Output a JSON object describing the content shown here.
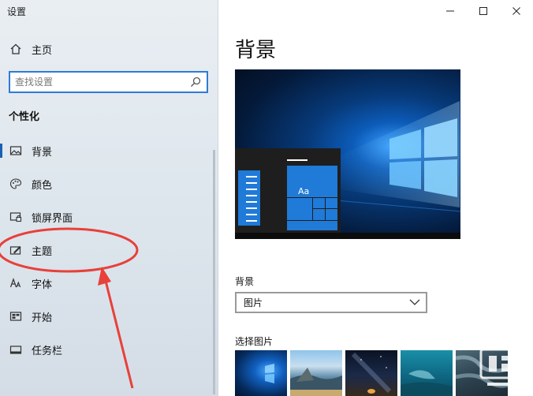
{
  "window": {
    "title": "设置",
    "controls": [
      "minimize-icon",
      "maximize-icon",
      "close-icon"
    ]
  },
  "sidebar": {
    "home_label": "主页",
    "search": {
      "placeholder": "查找设置",
      "value": ""
    },
    "section_title": "个性化",
    "items": [
      {
        "label": "背景",
        "icon": "image-icon",
        "selected": true
      },
      {
        "label": "颜色",
        "icon": "palette-icon",
        "selected": false
      },
      {
        "label": "锁屏界面",
        "icon": "lock-screen-icon",
        "selected": false
      },
      {
        "label": "主题",
        "icon": "theme-icon",
        "selected": false
      },
      {
        "label": "字体",
        "icon": "font-icon",
        "selected": false
      },
      {
        "label": "开始",
        "icon": "start-icon",
        "selected": false
      },
      {
        "label": "任务栏",
        "icon": "taskbar-icon",
        "selected": false
      }
    ]
  },
  "main": {
    "page_title": "背景",
    "preview": {
      "tile_text": "Aa"
    },
    "background_label": "背景",
    "background_dropdown": {
      "selected": "图片"
    },
    "choose_picture_label": "选择图片"
  },
  "annotation": {
    "color": "#e8403a"
  },
  "colors": {
    "accent": "#1a5fb4",
    "search_border": "#2f7bd6",
    "tile_blue": "#1f7ad8"
  }
}
